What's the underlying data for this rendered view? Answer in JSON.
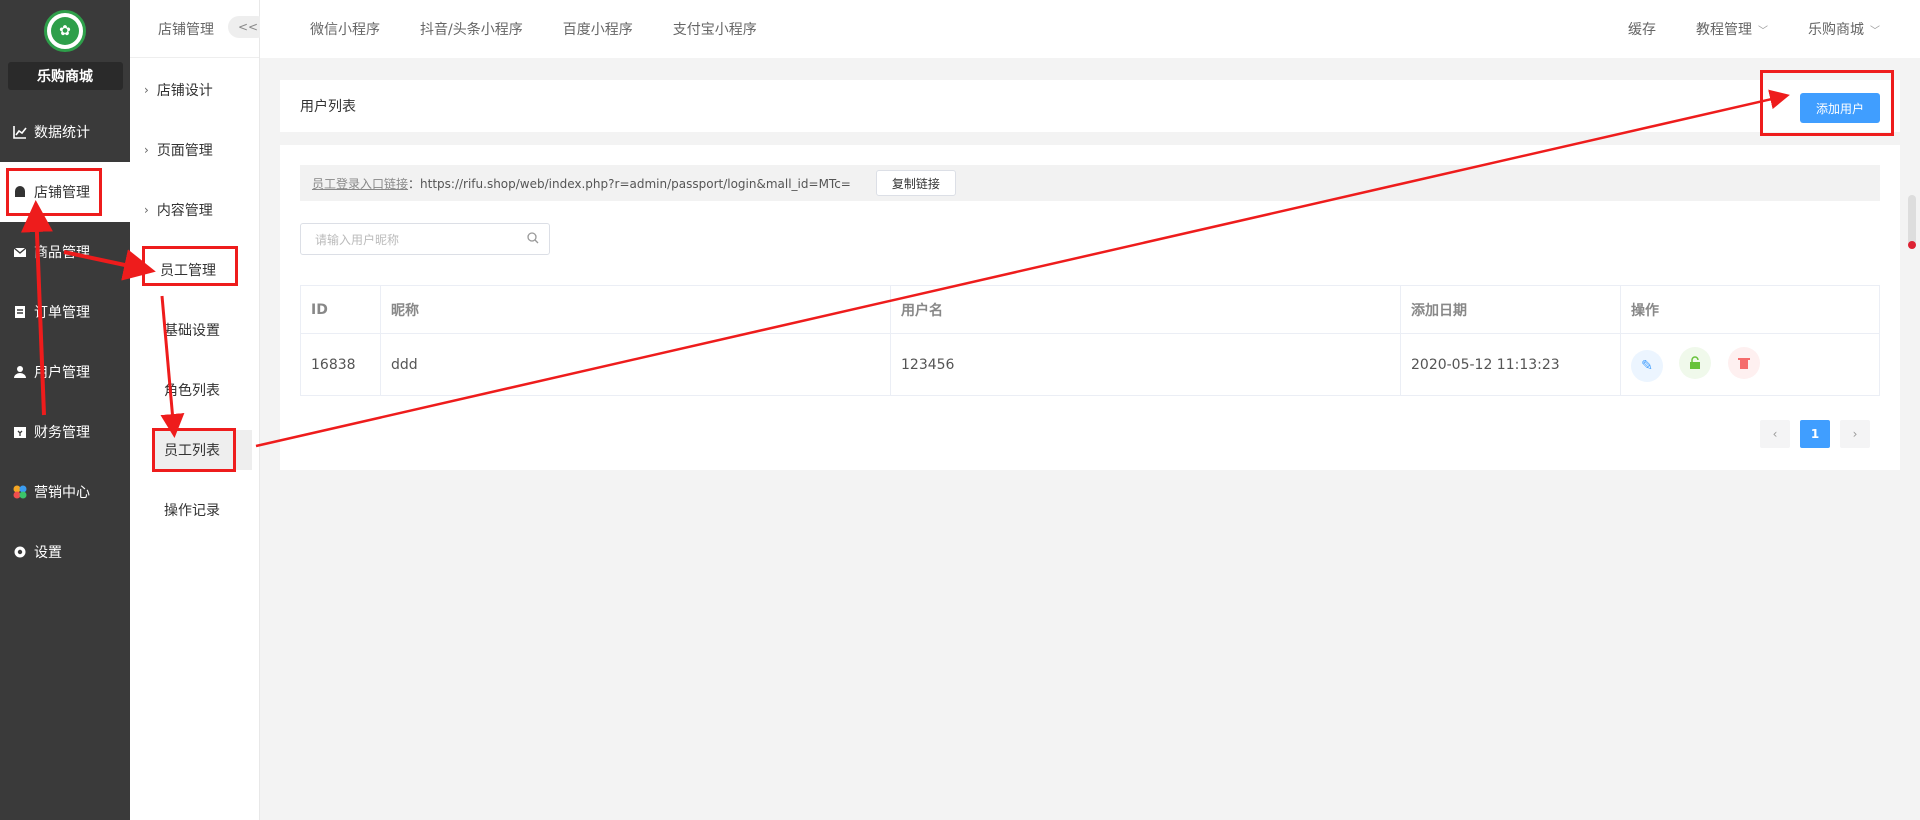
{
  "sidebar": {
    "shop_name": "乐购商城",
    "items": [
      {
        "label": "数据统计",
        "icon": "chart-icon"
      },
      {
        "label": "店铺管理",
        "icon": "store-icon"
      },
      {
        "label": "商品管理",
        "icon": "goods-icon"
      },
      {
        "label": "订单管理",
        "icon": "order-icon"
      },
      {
        "label": "用户管理",
        "icon": "user-icon"
      },
      {
        "label": "财务管理",
        "icon": "finance-icon"
      },
      {
        "label": "营销中心",
        "icon": "marketing-icon"
      },
      {
        "label": "设置",
        "icon": "gear-icon"
      }
    ]
  },
  "subnav": {
    "title": "店铺管理",
    "collapse": "<<",
    "items": [
      "店铺设计",
      "页面管理",
      "内容管理",
      "员工管理"
    ],
    "children": [
      "基础设置",
      "角色列表",
      "员工列表",
      "操作记录"
    ]
  },
  "topbar": {
    "tabs": [
      "微信小程序",
      "抖音/头条小程序",
      "百度小程序",
      "支付宝小程序"
    ],
    "right": [
      "缓存",
      "教程管理",
      "乐购商城"
    ]
  },
  "main": {
    "title": "用户列表",
    "add_button": "添加用户",
    "link_label": "员工登录入口链接",
    "link_url": "：https://rifu.shop/web/index.php?r=admin/passport/login&mall_id=MTc=",
    "copy_button": "复制链接",
    "search_placeholder": "请输入用户昵称",
    "columns": [
      "ID",
      "昵称",
      "用户名",
      "添加日期",
      "操作"
    ],
    "rows": [
      {
        "id": "16838",
        "nickname": "ddd",
        "username": "123456",
        "date": "2020-05-12 11:13:23"
      }
    ],
    "pager": {
      "prev": "‹",
      "current": "1",
      "next": "›"
    }
  },
  "colors": {
    "sidebar_bg": "#3a3a3a",
    "primary": "#409eff",
    "annotation": "#ee1c1c"
  }
}
